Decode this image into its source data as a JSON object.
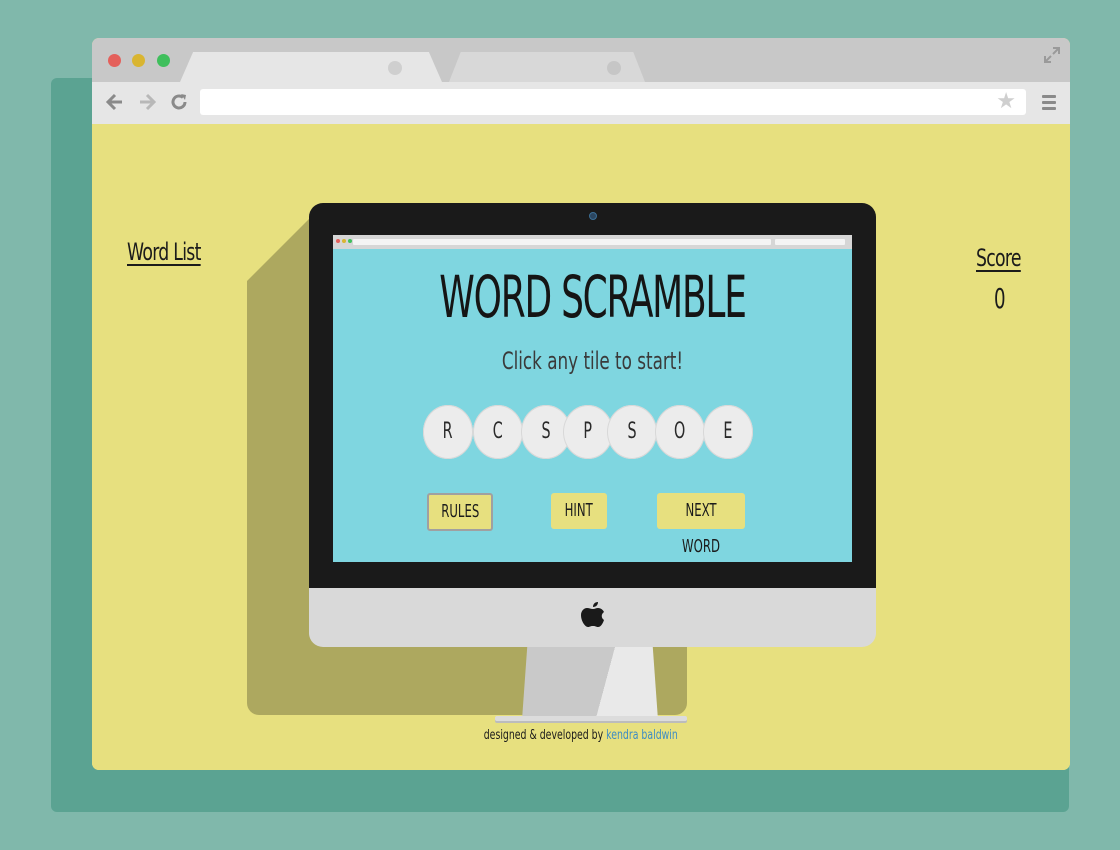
{
  "browser": {
    "window_controls": [
      "close",
      "minimize",
      "maximize"
    ],
    "icons": {
      "back": "arrow-left-icon",
      "forward": "arrow-right-icon",
      "reload": "reload-icon",
      "bookmark": "star-icon",
      "menu": "hamburger-menu-icon",
      "expand": "fullscreen-icon"
    },
    "url": ""
  },
  "page": {
    "word_list_label": "Word List",
    "score_label": "Score",
    "score_value": "0",
    "credit_prefix": "designed & developed by",
    "credit_author": "kendra baldwin"
  },
  "game": {
    "title": "WORD SCRAMBLE",
    "instruction": "Click any tile to start!",
    "tiles": [
      "R",
      "C",
      "S",
      "P",
      "S",
      "O",
      "E"
    ],
    "buttons": {
      "rules": "RULES",
      "hint": "HINT",
      "next_word": "NEXT WORD"
    }
  },
  "colors": {
    "background": "#80b8ab",
    "page_yellow": "#e7e07f",
    "screen_cyan": "#7fd6e0",
    "tile_gray": "#ececec",
    "link_blue": "#3d8cc4"
  }
}
